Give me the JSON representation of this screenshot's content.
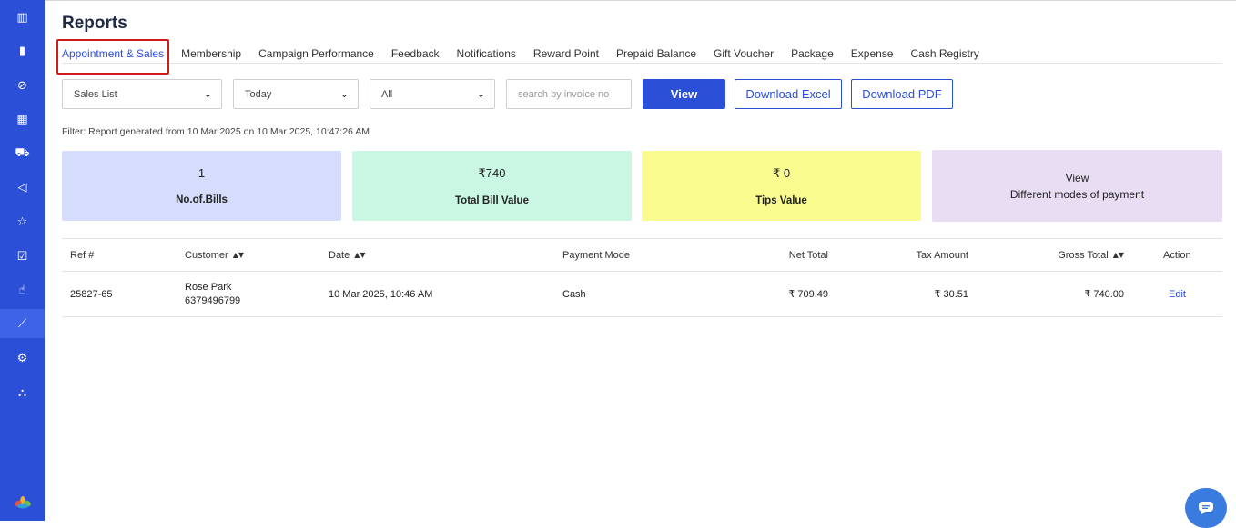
{
  "sidebar": {
    "icons": [
      {
        "name": "dashboard-icon",
        "glyph": "▥"
      },
      {
        "name": "analytics-icon",
        "glyph": "▮"
      },
      {
        "name": "check-circle-icon",
        "glyph": "⊘"
      },
      {
        "name": "calendar-icon",
        "glyph": "▦"
      },
      {
        "name": "car-icon",
        "glyph": "⛟"
      },
      {
        "name": "megaphone-icon",
        "glyph": "◁"
      },
      {
        "name": "star-icon",
        "glyph": "☆"
      },
      {
        "name": "calendar-check-icon",
        "glyph": "☑"
      },
      {
        "name": "hand-icon",
        "glyph": "☝"
      },
      {
        "name": "reports-chart-icon",
        "glyph": "⟋"
      },
      {
        "name": "settings-icon",
        "glyph": "⚙"
      },
      {
        "name": "sitemap-icon",
        "glyph": "⛬"
      }
    ],
    "active_index": 9,
    "brand_colors": [
      "#f2b233",
      "#e2523d",
      "#6cc04a",
      "#2f9fd8"
    ]
  },
  "page": {
    "title": "Reports"
  },
  "tabs": [
    "Appointment & Sales",
    "Membership",
    "Campaign Performance",
    "Feedback",
    "Notifications",
    "Reward Point",
    "Prepaid Balance",
    "Gift Voucher",
    "Package",
    "Expense",
    "Cash Registry"
  ],
  "active_tab": "Appointment & Sales",
  "filters": {
    "report_type": "Sales List",
    "period": "Today",
    "mode": "All",
    "search_placeholder": "search by invoice no",
    "view_label": "View",
    "download_excel_label": "Download Excel",
    "download_pdf_label": "Download PDF"
  },
  "filter_info": {
    "prefix": "Filter: Report generated from ",
    "from": "10 Mar 2025",
    "mid": " on ",
    "generated_on": "10 Mar 2025, 10:47:26 AM"
  },
  "summary": [
    {
      "value": "1",
      "label": "No.of.Bills",
      "color": "#d6dcfb"
    },
    {
      "value": "₹740",
      "label": "Total Bill Value",
      "color": "#c9f7e3"
    },
    {
      "value": "₹ 0",
      "label": "Tips Value",
      "color": "#fafc90"
    },
    {
      "value": "View",
      "label": "Different modes of payment",
      "color": "#e8ddf3"
    }
  ],
  "table": {
    "headers": {
      "ref": "Ref #",
      "customer": "Customer",
      "date": "Date",
      "payment_mode": "Payment Mode",
      "net_total": "Net Total",
      "tax_amount": "Tax Amount",
      "gross_total": "Gross Total",
      "action": "Action"
    },
    "rows": [
      {
        "ref": "25827-65",
        "customer_name": "Rose Park",
        "customer_phone": "6379496799",
        "date": "10 Mar 2025, 10:46 AM",
        "payment_mode": "Cash",
        "net_total": "₹ 709.49",
        "tax_amount": "₹ 30.51",
        "gross_total": "₹ 740.00",
        "action": "Edit"
      }
    ]
  }
}
